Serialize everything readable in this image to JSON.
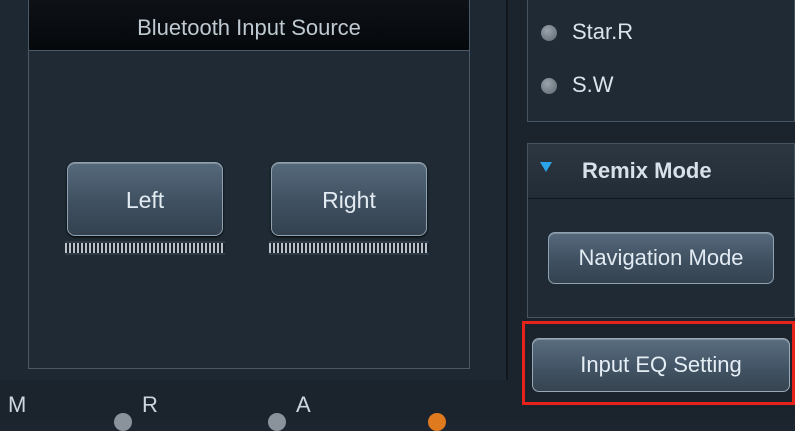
{
  "bluetooth_input": {
    "title": "Bluetooth Input Source",
    "left_label": "Left",
    "right_label": "Right"
  },
  "source_options": [
    {
      "label": "Star.R"
    },
    {
      "label": "S.W"
    }
  ],
  "remix": {
    "title": "Remix Mode",
    "navigation_label": "Navigation Mode"
  },
  "input_eq": {
    "label": "Input EQ Setting"
  },
  "mode_strip": {
    "label": "M",
    "option_1": "R",
    "option_2": "A"
  },
  "colors": {
    "accent": "#2aa3e8",
    "highlight": "#e5231b",
    "active_radio": "#e07a1f"
  },
  "icons": [
    "triangle-down-icon",
    "radio-icon"
  ]
}
